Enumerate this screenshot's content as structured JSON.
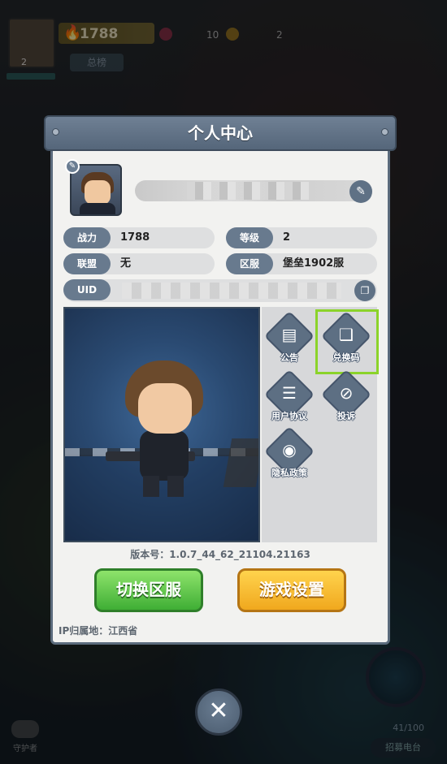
{
  "hud": {
    "power_value": "1788",
    "level": "2",
    "gem_value": "10",
    "coin_value": "2",
    "rank_label": "总榜",
    "compass_value": "41/100",
    "compass_button": "招募电台",
    "left_bottom_label": "守护者"
  },
  "panel": {
    "title": "个人中心",
    "fields": {
      "power_label": "战力",
      "power_value": "1788",
      "level_label": "等级",
      "level_value": "2",
      "alliance_label": "联盟",
      "alliance_value": "无",
      "server_label": "区服",
      "server_value": "堡垒1902服",
      "uid_label": "UID"
    },
    "menu": [
      {
        "label": "公告",
        "icon": "notice-icon"
      },
      {
        "label": "兑换码",
        "icon": "gift-icon"
      },
      {
        "label": "用户协议",
        "icon": "agreement-icon"
      },
      {
        "label": "投诉",
        "icon": "complaint-icon"
      },
      {
        "label": "隐私政策",
        "icon": "privacy-icon"
      }
    ],
    "version": "版本号：1.0.7_44_62_21104.21163",
    "switch_server": "切换区服",
    "game_settings": "游戏设置",
    "ip_location": "IP归属地：江西省"
  },
  "colors": {
    "accent": "#687a8e",
    "highlight": "#8bd32a",
    "green_button": "#3fae35",
    "yellow_button": "#f0a81e"
  }
}
